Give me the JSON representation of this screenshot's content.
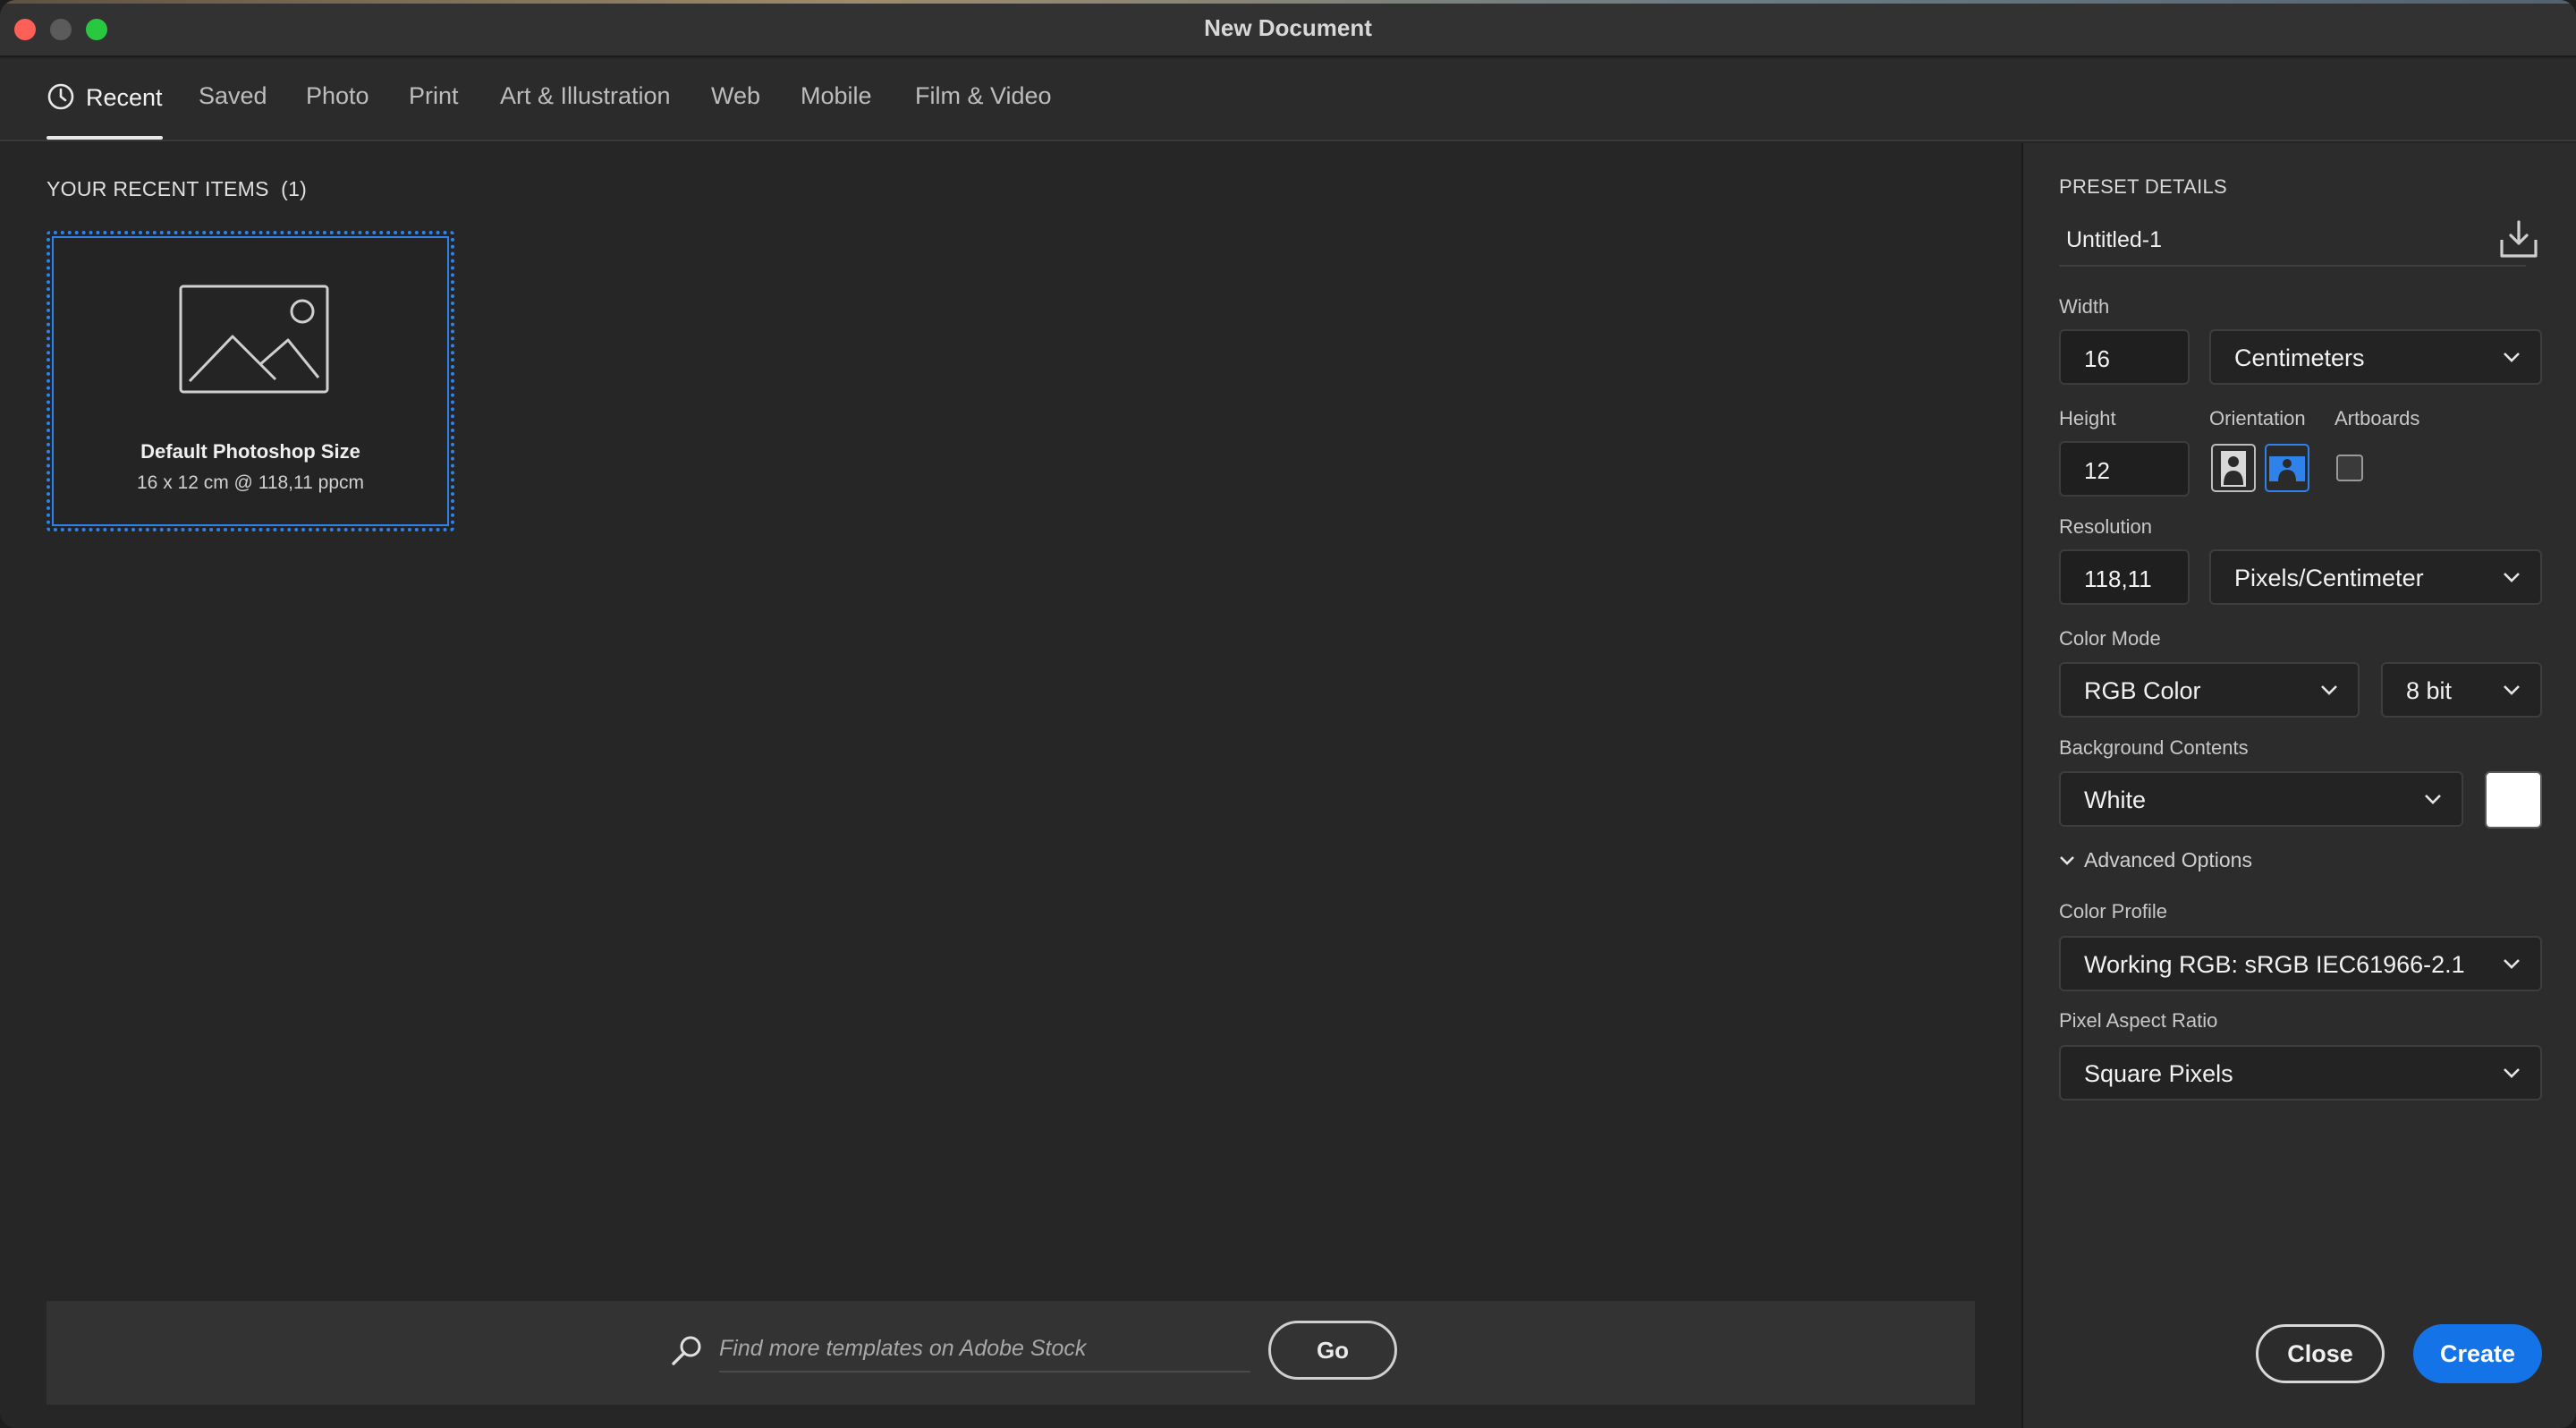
{
  "window": {
    "title": "New Document"
  },
  "tabs": [
    {
      "label": "Recent"
    },
    {
      "label": "Saved"
    },
    {
      "label": "Photo"
    },
    {
      "label": "Print"
    },
    {
      "label": "Art & Illustration"
    },
    {
      "label": "Web"
    },
    {
      "label": "Mobile"
    },
    {
      "label": "Film & Video"
    }
  ],
  "recent": {
    "heading": "YOUR RECENT ITEMS  (1)",
    "items": [
      {
        "name": "Default Photoshop Size",
        "info": "16 x 12 cm @ 118,11 ppcm"
      }
    ]
  },
  "search": {
    "placeholder": "Find more templates on Adobe Stock",
    "go_label": "Go"
  },
  "preset": {
    "heading": "PRESET DETAILS",
    "name": "Untitled-1",
    "width_label": "Width",
    "width_value": "16",
    "width_unit": "Centimeters",
    "height_label": "Height",
    "height_value": "12",
    "orientation_label": "Orientation",
    "artboards_label": "Artboards",
    "resolution_label": "Resolution",
    "resolution_value": "118,11",
    "resolution_unit": "Pixels/Centimeter",
    "color_mode_label": "Color Mode",
    "color_mode": "RGB Color",
    "bit_depth": "8 bit",
    "background_label": "Background Contents",
    "background": "White",
    "background_swatch": "#ffffff",
    "advanced_label": "Advanced Options",
    "color_profile_label": "Color Profile",
    "color_profile": "Working RGB: sRGB IEC61966-2.1",
    "pixel_aspect_label": "Pixel Aspect Ratio",
    "pixel_aspect": "Square Pixels"
  },
  "actions": {
    "close_label": "Close",
    "create_label": "Create"
  },
  "colors": {
    "accent": "#1473e6",
    "selection": "#2f82ea"
  }
}
